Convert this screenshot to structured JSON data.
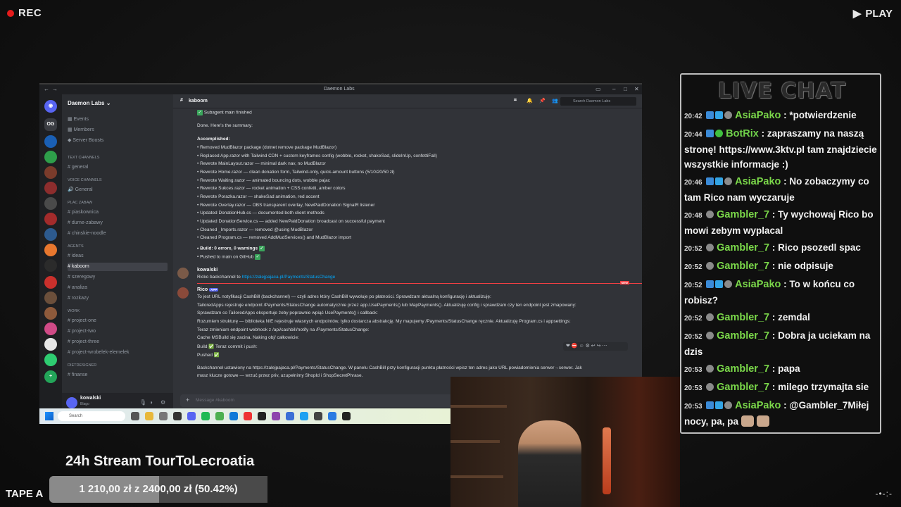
{
  "overlay": {
    "rec": "REC",
    "play": "PLAY",
    "tape": "TAPE A"
  },
  "discord": {
    "window_title": "Daemon Labs",
    "server_name": "Daemon Labs",
    "top_items": [
      "Events",
      "Members",
      "Server Boosts"
    ],
    "sections": [
      {
        "label": "Text Channels",
        "items": [
          "general"
        ]
      },
      {
        "label": "Voice Channels",
        "items": [
          "General"
        ]
      },
      {
        "label": "Plac Zabaw",
        "items": [
          "piaskownica",
          "durne-zabawy",
          "chinskie-noodle"
        ]
      },
      {
        "label": "Agents",
        "items": [
          "ideas",
          "kaboom",
          "szeregowy",
          "analiza",
          "rozkazy"
        ]
      },
      {
        "label": "WORK",
        "items": [
          "project-one",
          "project-two",
          "project-three",
          "project-wrobelek-elemelek"
        ]
      },
      {
        "label": "DietDesigner",
        "items": [
          "finanse"
        ]
      }
    ],
    "active_channel": "kaboom",
    "user": {
      "name": "kowalski",
      "status": "Blago"
    },
    "header_channel": "kaboom",
    "search_placeholder": "Search Daemon Labs",
    "composer_placeholder": "Message #kaboom",
    "messages": {
      "l1": "Subagent main finished",
      "l2": "Done. Here's the summary:",
      "l3": "Accomplished:",
      "bullets": [
        "Removed MudBlazor package (dotnet remove package MudBlazor)",
        "Replaced App.razor with Tailwind CDN + custom keyframes config (wobble, rocket, shakeSad, slideInUp, confettiFall)",
        "Rewrote MainLayout.razor — minimal dark nav, no MudBlazor",
        "Rewrote Home.razor — clean donation form, Tailwind-only, quick-amount buttons (5/10/20/50 zł)",
        "Rewrote Waiting.razor — animated bouncing dots, wobble pajac",
        "Rewrote Sukces.razor — rocket animation + CSS confetti, amber colors",
        "Rewrote Porazka.razor — shakeSad animation, red accent",
        "Rewrote Overlay.razor — OBS transparent overlay, NewPaidDonation SignalR listener",
        "Updated DonationHub.cs — documented both client methods",
        "Updated DonationService.cs — added NewPaidDonation broadcast on successful payment",
        "Cleaned _Imports.razor — removed @using MudBlazor",
        "Cleaned Program.cs — removed AddMudServices() and MudBlazor import"
      ],
      "build": "Build: 0 errors, 0 warnings",
      "pushed": "Pushed to main on GitHub",
      "kowalski_name": "kowalski",
      "kowalski_msg": "Ricko backchannel to",
      "kowalski_link": "https://zalejpajaca.pl/Payments/StatusChange",
      "rico_name": "Rico",
      "rico_lines": [
        "To jest URL notyfikacji CashBill (backchannel) — czyli adres który CashBill wywołuje po płatności. Sprawdzam aktualną konfigurację i aktualizuję:",
        "TailoredApps rejestruje endpoint /Payments/StatusChange automatycznie przez app.UsePayments() lub MapPayments(). Aktualizuję config i sprawdzam czy ten endpoint jest zmapowany:",
        "Sprawdzam co TailoredApps eksportuje żeby poprawnie wpiąć UsePayments() i callback:",
        "Rozumiem strukturę — biblioteka NIE rejestruje własnych endpointów, tylko dostarcza abstrakcję. My mapujemy /Payments/StatusChange ręcznie. Aktualizuję Program.cs i appsettings:",
        "Teraz zmieniam endpoint webhook z /api/cashbill/notify na /Payments/StatusChange:",
        "Cache MSBuild się zacina. Naking obj/ całkowicie:",
        "Build ✅ Teraz commit i push:",
        "Pushed ✅",
        "Backchannel ustawiony na https://zalejpajaca.pl/Payments/StatusChange. W panelu CashBill przy konfiguracji punktu płatności wpisz ten adres jako URL powiadomienia serwer→serwer. Jak",
        "masz klucze gotowe — wrzuć przez priv, uzupełnimy ShopId i ShopSecretPhrase."
      ]
    }
  },
  "taskbar": {
    "search": "Search"
  },
  "livechat": {
    "title": "LIVE CHAT",
    "messages": [
      {
        "time": "20:42",
        "name": "AsiaPako",
        "text": ": *potwierdzenie"
      },
      {
        "time": "20:44",
        "name": "BotRix",
        "text": ": zapraszamy na naszą stronę! https://www.3ktv.pl tam znajdziecie wszystkie informacje :)"
      },
      {
        "time": "20:46",
        "name": "AsiaPako",
        "text": ": No zobaczymy co tam Rico nam wyczaruje"
      },
      {
        "time": "20:48",
        "name": "Gambler_7",
        "text": ": Ty wychowaj Rico bo mowi zebym wyplacal"
      },
      {
        "time": "20:52",
        "name": "Gambler_7",
        "text": ": Rico psozedl spac"
      },
      {
        "time": "20:52",
        "name": "Gambler_7",
        "text": ": nie odpisuje"
      },
      {
        "time": "20:52",
        "name": "AsiaPako",
        "text": ": To w końcu co robisz?"
      },
      {
        "time": "20:52",
        "name": "Gambler_7",
        "text": ": zemdal"
      },
      {
        "time": "20:52",
        "name": "Gambler_7",
        "text": ": Dobra ja uciekam na dzis"
      },
      {
        "time": "20:53",
        "name": "Gambler_7",
        "text": ": papa"
      },
      {
        "time": "20:53",
        "name": "Gambler_7",
        "text": ": milego trzymajta sie"
      },
      {
        "time": "20:53",
        "name": "AsiaPako",
        "text": ": @Gambler_7Miłej nocy, pa, pa"
      }
    ]
  },
  "donation": {
    "title": "24h Stream TourToLecroatia",
    "progress_text": "1 210,00 zł z 2400,00 zł (50.42%)",
    "progress": 0.5042
  }
}
